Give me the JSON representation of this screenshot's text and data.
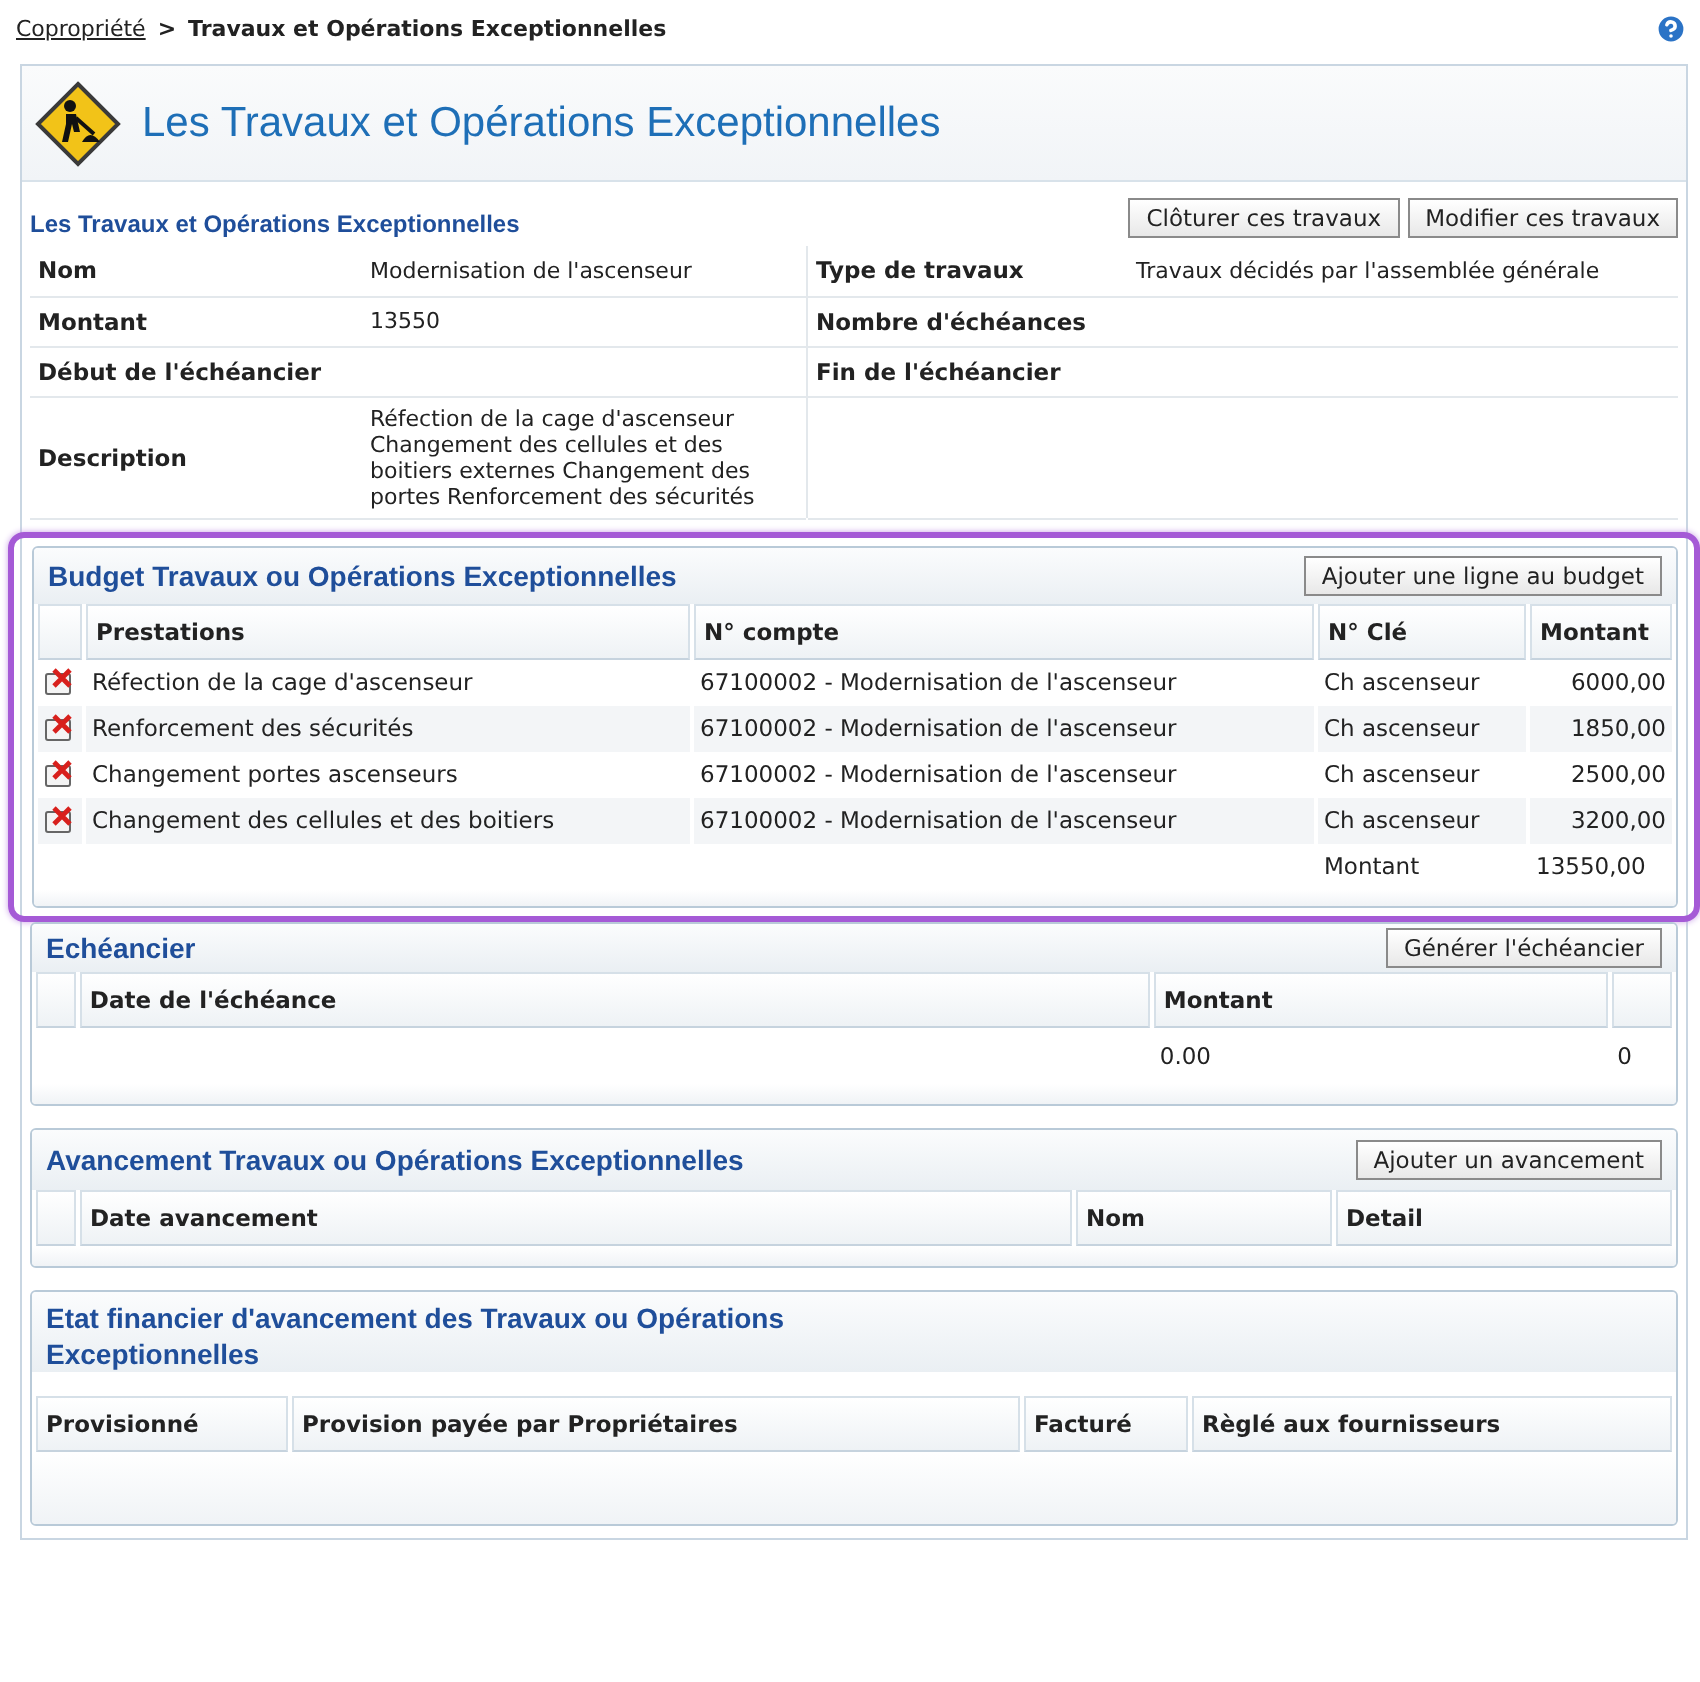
{
  "breadcrumb": {
    "link": "Copropriété",
    "separator": ">",
    "current": "Travaux et Opérations Exceptionnelles"
  },
  "page_title": "Les Travaux et Opérations Exceptionnelles",
  "details": {
    "title": "Les Travaux et Opérations Exceptionnelles",
    "buttons": [
      "Clôturer ces travaux",
      "Modifier ces travaux"
    ],
    "rows": [
      {
        "cells": [
          {
            "label": "Nom",
            "value": "Modernisation de l'ascenseur"
          },
          {
            "label": "Type de travaux",
            "value": "Travaux décidés par l'assemblée générale"
          }
        ]
      },
      {
        "cells": [
          {
            "label": "Montant",
            "value": "13550"
          },
          {
            "label": "Nombre d'échéances"
          }
        ]
      },
      {
        "cells": [
          {
            "label": "Début de l'échéancier"
          },
          {
            "label": "Fin de l'échéancier"
          }
        ]
      },
      {
        "cells": [
          {
            "label": "Description",
            "value": "Réfection de la cage d'ascenseur Changement des cellules et des boitiers externes Changement des portes Renforcement des sécurités"
          }
        ]
      }
    ]
  },
  "budget": {
    "title": "Budget Travaux ou Opérations Exceptionnelles",
    "highlighted": true,
    "button": "Ajouter une ligne au budget",
    "columns": [
      "Prestations",
      "N° compte",
      "N° Clé",
      "Montant"
    ],
    "rows": [
      {
        "prestation": "Réfection de la cage d'ascenseur",
        "compte": "67100002 - Modernisation de l'ascenseur",
        "cle": "Ch ascenseur",
        "montant": "6000,00"
      },
      {
        "prestation": "Renforcement des sécurités",
        "compte": "67100002 - Modernisation de l'ascenseur",
        "cle": "Ch ascenseur",
        "montant": "1850,00"
      },
      {
        "prestation": "Changement portes ascenseurs",
        "compte": "67100002 - Modernisation de l'ascenseur",
        "cle": "Ch ascenseur",
        "montant": "2500,00"
      },
      {
        "prestation": "Changement des cellules et des boitiers",
        "compte": "67100002 - Modernisation de l'ascenseur",
        "cle": "Ch ascenseur",
        "montant": "3200,00"
      }
    ],
    "total_label": "Montant",
    "total": "13550,00"
  },
  "echeancier": {
    "title": "Echéancier",
    "button": "Générer l'échéancier",
    "columns": [
      "Date de l'échéance",
      "Montant"
    ],
    "rows": [
      {
        "montant": "0.00",
        "column_3": "0"
      }
    ]
  },
  "avancement": {
    "title": "Avancement Travaux ou Opérations Exceptionnelles",
    "button": "Ajouter un avancement",
    "columns": [
      "Date avancement",
      "Nom",
      "Detail"
    ]
  },
  "etat_financier": {
    "title": "Etat financier d'avancement des Travaux ou Opérations Exceptionnelles",
    "columns": [
      "Provisionné",
      "Provision payée par Propriétaires",
      "Facturé",
      "Règlé aux fournisseurs"
    ]
  }
}
